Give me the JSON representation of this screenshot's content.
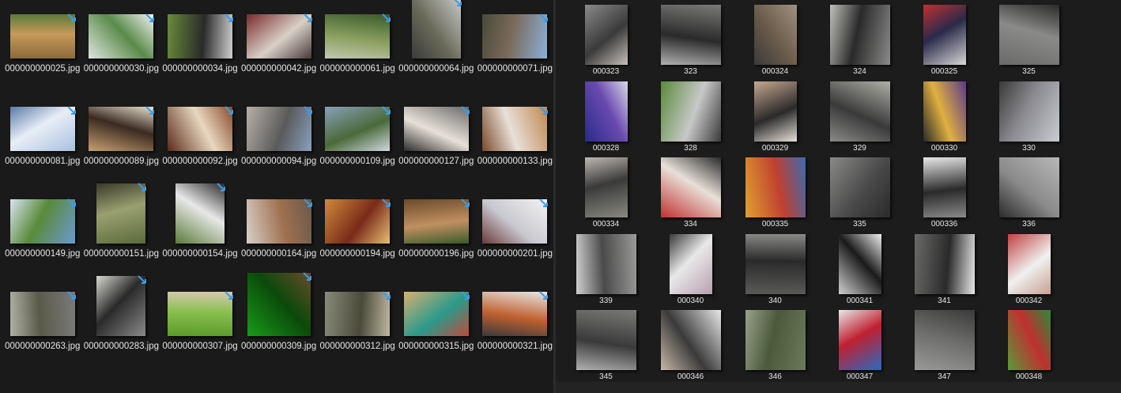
{
  "left_pane": {
    "items": [
      {
        "name": "000000000025.jpg",
        "colors": [
          "#8a6a3a",
          "#c79a5a",
          "#5a7a3a"
        ],
        "shape": "wide"
      },
      {
        "name": "000000000030.jpg",
        "colors": [
          "#dfe6df",
          "#5a8a4a",
          "#f2f2f2"
        ],
        "shape": "wide"
      },
      {
        "name": "000000000034.jpg",
        "colors": [
          "#6a8a3a",
          "#2a2a2a",
          "#cfcfcf"
        ],
        "shape": "wide"
      },
      {
        "name": "000000000042.jpg",
        "colors": [
          "#7a2a2a",
          "#d8d0c8",
          "#4a3a3a"
        ],
        "shape": "wide"
      },
      {
        "name": "000000000061.jpg",
        "colors": [
          "#3a5a2a",
          "#8aa060",
          "#c0c8b0"
        ],
        "shape": "wide"
      },
      {
        "name": "000000000064.jpg",
        "colors": [
          "#c8c8c8",
          "#6a6a5a",
          "#3a3a3a"
        ],
        "shape": "tall"
      },
      {
        "name": "000000000071.jpg",
        "colors": [
          "#8ab0d8",
          "#7a6a5a",
          "#4a4a3a"
        ],
        "shape": "wide"
      },
      {
        "name": "000000000081.jpg",
        "colors": [
          "#a8c0e0",
          "#e8eef6",
          "#5a7aa8"
        ],
        "shape": "wide"
      },
      {
        "name": "000000000089.jpg",
        "colors": [
          "#c8a070",
          "#3a2a20",
          "#e8e0d0"
        ],
        "shape": "wide"
      },
      {
        "name": "000000000092.jpg",
        "colors": [
          "#5a2a1a",
          "#e8d8c0",
          "#8a4a2a"
        ],
        "shape": "wide"
      },
      {
        "name": "000000000094.jpg",
        "colors": [
          "#b8b0a8",
          "#5a5a5a",
          "#8aa0c0"
        ],
        "shape": "wide"
      },
      {
        "name": "000000000109.jpg",
        "colors": [
          "#8aa0b8",
          "#4a6a3a",
          "#d0d8e0"
        ],
        "shape": "wide"
      },
      {
        "name": "000000000127.jpg",
        "colors": [
          "#6a6a6a",
          "#e8e0d8",
          "#2a2a2a"
        ],
        "shape": "wide"
      },
      {
        "name": "000000000133.jpg",
        "colors": [
          "#c08850",
          "#e8e0d8",
          "#7a4a2a"
        ],
        "shape": "wide"
      },
      {
        "name": "000000000149.jpg",
        "colors": [
          "#6a9ad0",
          "#5a8a3a",
          "#d8e4f0"
        ],
        "shape": "wide"
      },
      {
        "name": "000000000151.jpg",
        "colors": [
          "#5a6a3a",
          "#9aa070",
          "#3a3a2a"
        ],
        "shape": "tall"
      },
      {
        "name": "000000000154.jpg",
        "colors": [
          "#5a7a3a",
          "#e8e8e8",
          "#2a2a2a"
        ],
        "shape": "tall"
      },
      {
        "name": "000000000164.jpg",
        "colors": [
          "#d8d0c8",
          "#a07050",
          "#6a5a4a"
        ],
        "shape": "wide"
      },
      {
        "name": "000000000194.jpg",
        "colors": [
          "#d08a3a",
          "#7a2a1a",
          "#e8c070"
        ],
        "shape": "wide"
      },
      {
        "name": "000000000196.jpg",
        "colors": [
          "#6a4a2a",
          "#c09060",
          "#3a5a2a"
        ],
        "shape": "wide"
      },
      {
        "name": "000000000201.jpg",
        "colors": [
          "#f2f2f2",
          "#c8c8d0",
          "#6a3a3a"
        ],
        "shape": "wide"
      },
      {
        "name": "000000000263.jpg",
        "colors": [
          "#7a7a7a",
          "#5a5a4a",
          "#b0b0a8"
        ],
        "shape": "wide"
      },
      {
        "name": "000000000283.jpg",
        "colors": [
          "#8a8a8a",
          "#2a2a2a",
          "#d8d8d0"
        ],
        "shape": "tall"
      },
      {
        "name": "000000000307.jpg",
        "colors": [
          "#5a9a2a",
          "#8ac050",
          "#d8c8b0"
        ],
        "shape": "wide"
      },
      {
        "name": "000000000309.jpg",
        "colors": [
          "#1a9a1a",
          "#0a4a0a",
          "#6a4a2a"
        ],
        "shape": "square"
      },
      {
        "name": "000000000312.jpg",
        "colors": [
          "#8a8a7a",
          "#4a4a3a",
          "#c0b8a0"
        ],
        "shape": "wide"
      },
      {
        "name": "000000000315.jpg",
        "colors": [
          "#d8b070",
          "#2a9a8a",
          "#c04a3a"
        ],
        "shape": "wide"
      },
      {
        "name": "000000000321.jpg",
        "colors": [
          "#e8e8e8",
          "#c06030",
          "#3a3a3a"
        ],
        "shape": "wide"
      }
    ]
  },
  "right_pane": {
    "items": [
      {
        "name": "000323",
        "colors": [
          "#8a8a8a",
          "#3a3a3a",
          "#c8c0b8"
        ],
        "shape": "tall"
      },
      {
        "name": "323",
        "colors": [
          "#7a7a78",
          "#2a2a2a",
          "#b0b0b0"
        ],
        "shape": "wide"
      },
      {
        "name": "000324",
        "colors": [
          "#a09080",
          "#6a5a4a",
          "#3a3a3a"
        ],
        "shape": "tall"
      },
      {
        "name": "324",
        "colors": [
          "#8a8a88",
          "#2a2a2a",
          "#c0c0b8"
        ],
        "shape": "wide"
      },
      {
        "name": "000325",
        "colors": [
          "#d8d8d8",
          "#2a2a4a",
          "#c03030"
        ],
        "shape": "tall"
      },
      {
        "name": "325",
        "colors": [
          "#6a6a68",
          "#8a8a88",
          "#2a2a2a"
        ],
        "shape": "wide"
      },
      {
        "name": "000328",
        "colors": [
          "#2a2a8a",
          "#6a4ab0",
          "#d8d8e8"
        ],
        "shape": "tall"
      },
      {
        "name": "328",
        "colors": [
          "#5a8a3a",
          "#c8c8c8",
          "#3a3a3a"
        ],
        "shape": "wide"
      },
      {
        "name": "000329",
        "colors": [
          "#c8a890",
          "#2a2a2a",
          "#e8e0d8"
        ],
        "shape": "tall"
      },
      {
        "name": "329",
        "colors": [
          "#b0b0a8",
          "#3a3a3a",
          "#8a8a88"
        ],
        "shape": "wide"
      },
      {
        "name": "000330",
        "colors": [
          "#5a3a8a",
          "#e0b040",
          "#2a2a2a"
        ],
        "shape": "tall"
      },
      {
        "name": "330",
        "colors": [
          "#c8ccd0",
          "#8a8a90",
          "#3a3a3a"
        ],
        "shape": "wide"
      },
      {
        "name": "000334",
        "colors": [
          "#8a8a80",
          "#3a3a3a",
          "#c0b8b0"
        ],
        "shape": "tall"
      },
      {
        "name": "334",
        "colors": [
          "#c03030",
          "#e8e0d8",
          "#2a2a2a"
        ],
        "shape": "wide"
      },
      {
        "name": "000335",
        "colors": [
          "#e0a030",
          "#c04030",
          "#3a6ab0"
        ],
        "shape": "wide"
      },
      {
        "name": "335",
        "colors": [
          "#8a8a88",
          "#4a4a4a",
          "#2a2a2a"
        ],
        "shape": "wide"
      },
      {
        "name": "000336",
        "colors": [
          "#e8e8e8",
          "#2a2a2a",
          "#8a8a8a"
        ],
        "shape": "tall"
      },
      {
        "name": "336",
        "colors": [
          "#b8b8b8",
          "#8a8a8a",
          "#2a2a2a"
        ],
        "shape": "wide"
      },
      {
        "name": "339",
        "colors": [
          "#9a9a98",
          "#4a4a4a",
          "#d0d0d0"
        ],
        "shape": "wide"
      },
      {
        "name": "000340",
        "colors": [
          "#b8a0b0",
          "#e8e8e8",
          "#3a3a3a"
        ],
        "shape": "tall"
      },
      {
        "name": "340",
        "colors": [
          "#5a5a58",
          "#2a2a2a",
          "#8a8a88"
        ],
        "shape": "wide"
      },
      {
        "name": "000341",
        "colors": [
          "#d0d0d0",
          "#1a1a1a",
          "#f0f0f0"
        ],
        "shape": "tall"
      },
      {
        "name": "341",
        "colors": [
          "#6a6a68",
          "#2a2a2a",
          "#e8e8e8"
        ],
        "shape": "wide"
      },
      {
        "name": "000342",
        "colors": [
          "#c04040",
          "#f0f0f0",
          "#c8a090"
        ],
        "shape": "tall"
      },
      {
        "name": "345",
        "colors": [
          "#7a7a78",
          "#3a3a3a",
          "#b0b0b0"
        ],
        "shape": "wide"
      },
      {
        "name": "000346",
        "colors": [
          "#e8e8e8",
          "#3a3a3a",
          "#c8b8a8"
        ],
        "shape": "wide"
      },
      {
        "name": "346",
        "colors": [
          "#6a7a5a",
          "#4a5a3a",
          "#9aa08a"
        ],
        "shape": "wide"
      },
      {
        "name": "000347",
        "colors": [
          "#2a6ac0",
          "#c02030",
          "#e8e8e8"
        ],
        "shape": "tall"
      },
      {
        "name": "347",
        "colors": [
          "#9a9a98",
          "#6a6a68",
          "#3a3a3a"
        ],
        "shape": "wide"
      },
      {
        "name": "000348",
        "colors": [
          "#5a9a3a",
          "#c03030",
          "#2a8a3a"
        ],
        "shape": "tall"
      }
    ]
  },
  "colors": {
    "left_background": "#1a1a1a",
    "right_background": "#1c1c1c",
    "text": "#e4e4e4",
    "sync_icon": "#3a9ce8"
  }
}
